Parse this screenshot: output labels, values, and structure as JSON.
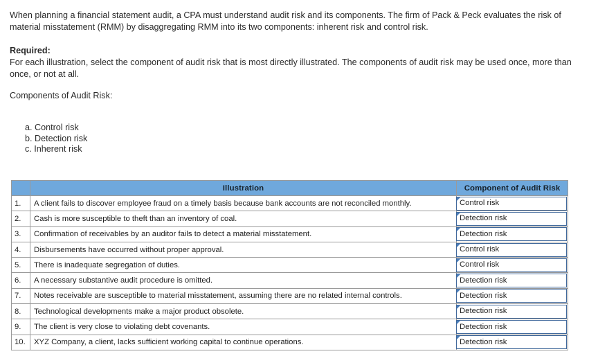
{
  "intro": {
    "paragraph": "When planning a financial statement audit, a CPA must understand audit risk and its components. The firm of Pack & Peck evaluates the risk of material misstatement (RMM) by disaggregating RMM into its two components: inherent risk and control risk."
  },
  "required": {
    "label": "Required:",
    "body": "For each illustration, select the component of audit risk that is most directly illustrated. The components of audit risk may be used once, more than once, or not at all."
  },
  "components": {
    "heading": "Components of Audit Risk:",
    "options": [
      "a. Control risk",
      "b. Detection risk",
      "c. Inherent risk"
    ]
  },
  "table": {
    "headers": {
      "number": "",
      "illustration": "Illustration",
      "component": "Component of Audit Risk"
    },
    "header_bg": "#6fa8dc",
    "select_border": "#41699c",
    "rows": [
      {
        "number": "1.",
        "illustration": "A client fails to discover employee fraud on a timely basis because bank accounts are not reconciled monthly.",
        "answer": "Control risk"
      },
      {
        "number": "2.",
        "illustration": "Cash is more susceptible to theft than an inventory of coal.",
        "answer": "Detection risk"
      },
      {
        "number": "3.",
        "illustration": "Confirmation of receivables by an auditor fails to detect a material misstatement.",
        "answer": "Detection risk"
      },
      {
        "number": "4.",
        "illustration": "Disbursements have occurred without proper approval.",
        "answer": "Control risk"
      },
      {
        "number": "5.",
        "illustration": "There is inadequate segregation of duties.",
        "answer": "Control risk"
      },
      {
        "number": "6.",
        "illustration": "A necessary substantive audit procedure is omitted.",
        "answer": "Detection risk"
      },
      {
        "number": "7.",
        "illustration": "Notes receivable are susceptible to material misstatement, assuming there are no related internal controls.",
        "answer": "Detection risk"
      },
      {
        "number": "8.",
        "illustration": "Technological developments make a major product obsolete.",
        "answer": "Detection risk"
      },
      {
        "number": "9.",
        "illustration": "The client is very close to violating debt covenants.",
        "answer": "Detection risk"
      },
      {
        "number": "10.",
        "illustration": "XYZ Company, a client, lacks sufficient working capital to continue operations.",
        "answer": "Detection risk"
      }
    ]
  }
}
